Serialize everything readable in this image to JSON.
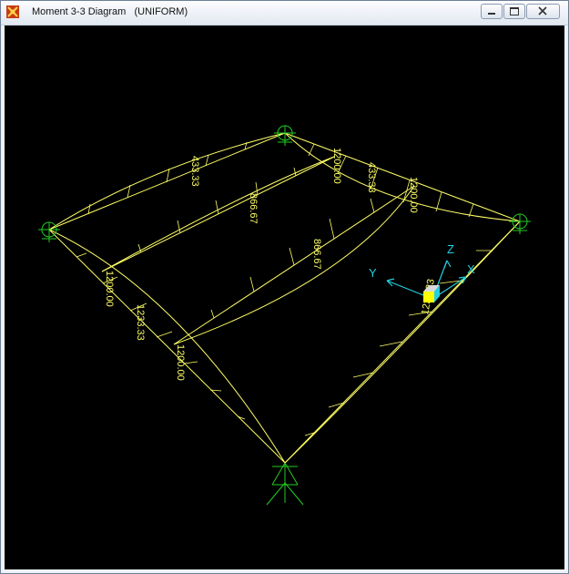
{
  "window": {
    "title": "Moment 3-3 Diagram   (UNIFORM)",
    "icon": "sap-app-icon"
  },
  "controls": {
    "minimize_icon": "minimize-icon",
    "maximize_icon": "maximize-icon",
    "close_icon": "close-icon"
  },
  "colors": {
    "background": "#000000",
    "frame": "#ffff66",
    "supports": "#22cc22",
    "axes": "#22d0e0"
  },
  "diagram": {
    "labels": [
      "433.33",
      "1200.00",
      "433.33",
      "1200.00",
      "866.67",
      "866.67",
      "1200.00",
      "1233.33",
      "1200.00",
      "1233.33"
    ],
    "axes": {
      "x": "X",
      "y": "Y",
      "z": "Z"
    }
  }
}
